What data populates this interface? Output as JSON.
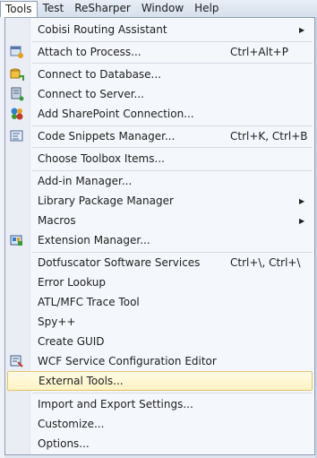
{
  "menubar": {
    "items": [
      "Tools",
      "Test",
      "ReSharper",
      "Window",
      "Help"
    ]
  },
  "menu": {
    "items": [
      {
        "label": "Cobisi Routing Assistant",
        "shortcut": "",
        "submenu": true,
        "icon": "none"
      },
      {
        "label": "Attach to Process...",
        "shortcut": "Ctrl+Alt+P",
        "submenu": false,
        "icon": "attach-process-icon"
      },
      {
        "label": "Connect to Database...",
        "shortcut": "",
        "submenu": false,
        "icon": "database-connect-icon"
      },
      {
        "label": "Connect to Server...",
        "shortcut": "",
        "submenu": false,
        "icon": "server-connect-icon"
      },
      {
        "label": "Add SharePoint Connection...",
        "shortcut": "",
        "submenu": false,
        "icon": "sharepoint-icon"
      },
      {
        "label": "Code Snippets Manager...",
        "shortcut": "Ctrl+K, Ctrl+B",
        "submenu": false,
        "icon": "snippets-icon"
      },
      {
        "label": "Choose Toolbox Items...",
        "shortcut": "",
        "submenu": false,
        "icon": "none"
      },
      {
        "label": "Add-in Manager...",
        "shortcut": "",
        "submenu": false,
        "icon": "none"
      },
      {
        "label": "Library Package Manager",
        "shortcut": "",
        "submenu": true,
        "icon": "none"
      },
      {
        "label": "Macros",
        "shortcut": "",
        "submenu": true,
        "icon": "none"
      },
      {
        "label": "Extension Manager...",
        "shortcut": "",
        "submenu": false,
        "icon": "extension-manager-icon"
      },
      {
        "label": "Dotfuscator Software Services",
        "shortcut": "Ctrl+\\, Ctrl+\\",
        "submenu": false,
        "icon": "none"
      },
      {
        "label": "Error Lookup",
        "shortcut": "",
        "submenu": false,
        "icon": "none"
      },
      {
        "label": "ATL/MFC Trace Tool",
        "shortcut": "",
        "submenu": false,
        "icon": "none"
      },
      {
        "label": "Spy++",
        "shortcut": "",
        "submenu": false,
        "icon": "none"
      },
      {
        "label": "Create GUID",
        "shortcut": "",
        "submenu": false,
        "icon": "none"
      },
      {
        "label": "WCF Service Configuration Editor",
        "shortcut": "",
        "submenu": false,
        "icon": "wcf-editor-icon"
      },
      {
        "label": "External Tools...",
        "shortcut": "",
        "submenu": false,
        "icon": "none",
        "highlighted": true
      },
      {
        "label": "Import and Export Settings...",
        "shortcut": "",
        "submenu": false,
        "icon": "none"
      },
      {
        "label": "Customize...",
        "shortcut": "",
        "submenu": false,
        "icon": "none"
      },
      {
        "label": "Options...",
        "shortcut": "",
        "submenu": false,
        "icon": "none"
      }
    ]
  },
  "colors": {
    "highlight": "#fff3c4",
    "highlight_border": "#e5c365"
  }
}
